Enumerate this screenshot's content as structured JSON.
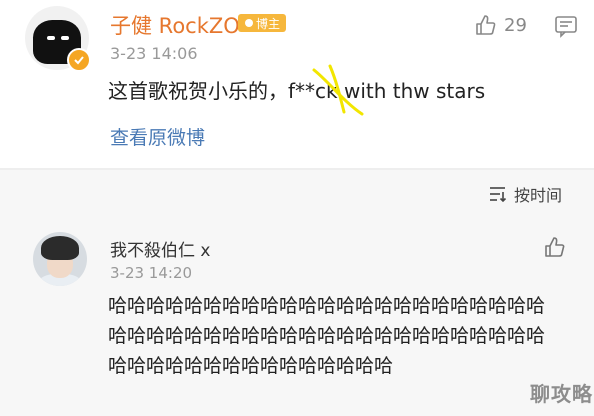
{
  "post": {
    "username": "子健 RockZO",
    "badge": "博主",
    "timestamp": "3-23 14:06",
    "like_count": "29",
    "content": "这首歌祝贺小乐的，f**ck with thw stars",
    "view_original": "查看原微博"
  },
  "sort": {
    "label": "按时间"
  },
  "reply": {
    "username": "我不殺伯仁 x",
    "timestamp": "3-23 14:20",
    "content": "哈哈哈哈哈哈哈哈哈哈哈哈哈哈哈哈哈哈哈哈哈哈哈哈哈哈哈哈哈哈哈哈哈哈哈哈哈哈哈哈哈哈哈哈哈哈哈哈哈哈哈哈哈哈哈哈哈哈哈哈哈"
  },
  "watermark": "聊攻略",
  "colors": {
    "username": "#e6772e",
    "link": "#4a7ab5",
    "badge": "#f6b73c",
    "scribble": "#f2e600"
  },
  "icons": [
    "thumbs-up-icon",
    "message-icon",
    "sort-icon",
    "verified-icon"
  ]
}
